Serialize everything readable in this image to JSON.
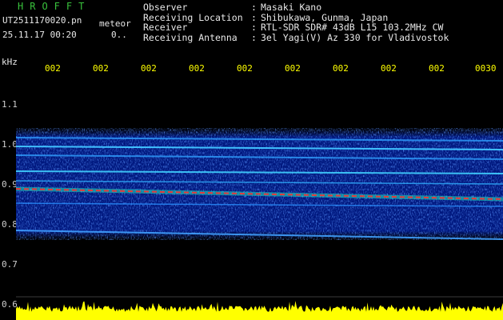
{
  "header": {
    "app_title": "HROFFT",
    "filename": "UT2511170020.pn",
    "category": "meteor",
    "date": "25.11.17 00:20",
    "extra": "0..",
    "info": [
      {
        "label": "Observer",
        "value": "Masaki Kano"
      },
      {
        "label": "Receiving Location",
        "value": "Shibukawa, Gunma, Japan"
      },
      {
        "label": "Receiver",
        "value": "RTL-SDR SDR# 43dB L15 103.2MHz CW"
      },
      {
        "label": "Receiving Antenna",
        "value": "3el Yagi(V) Az 330 for Vladivostok"
      }
    ]
  },
  "axis": {
    "unit": "kHz",
    "time_ticks": [
      "002",
      "002",
      "002",
      "002",
      "002",
      "002",
      "002",
      "002",
      "002",
      "0030"
    ],
    "freq_ticks": [
      "1.1",
      "1.0",
      "0.9",
      "0.8",
      "0.7",
      "0.6"
    ]
  },
  "colors": {
    "background": "#000000",
    "title": "#39c23c",
    "time_tick": "#ffff00",
    "noise_floor": "#ffff00",
    "meteor_trace": "#ff3030"
  }
}
